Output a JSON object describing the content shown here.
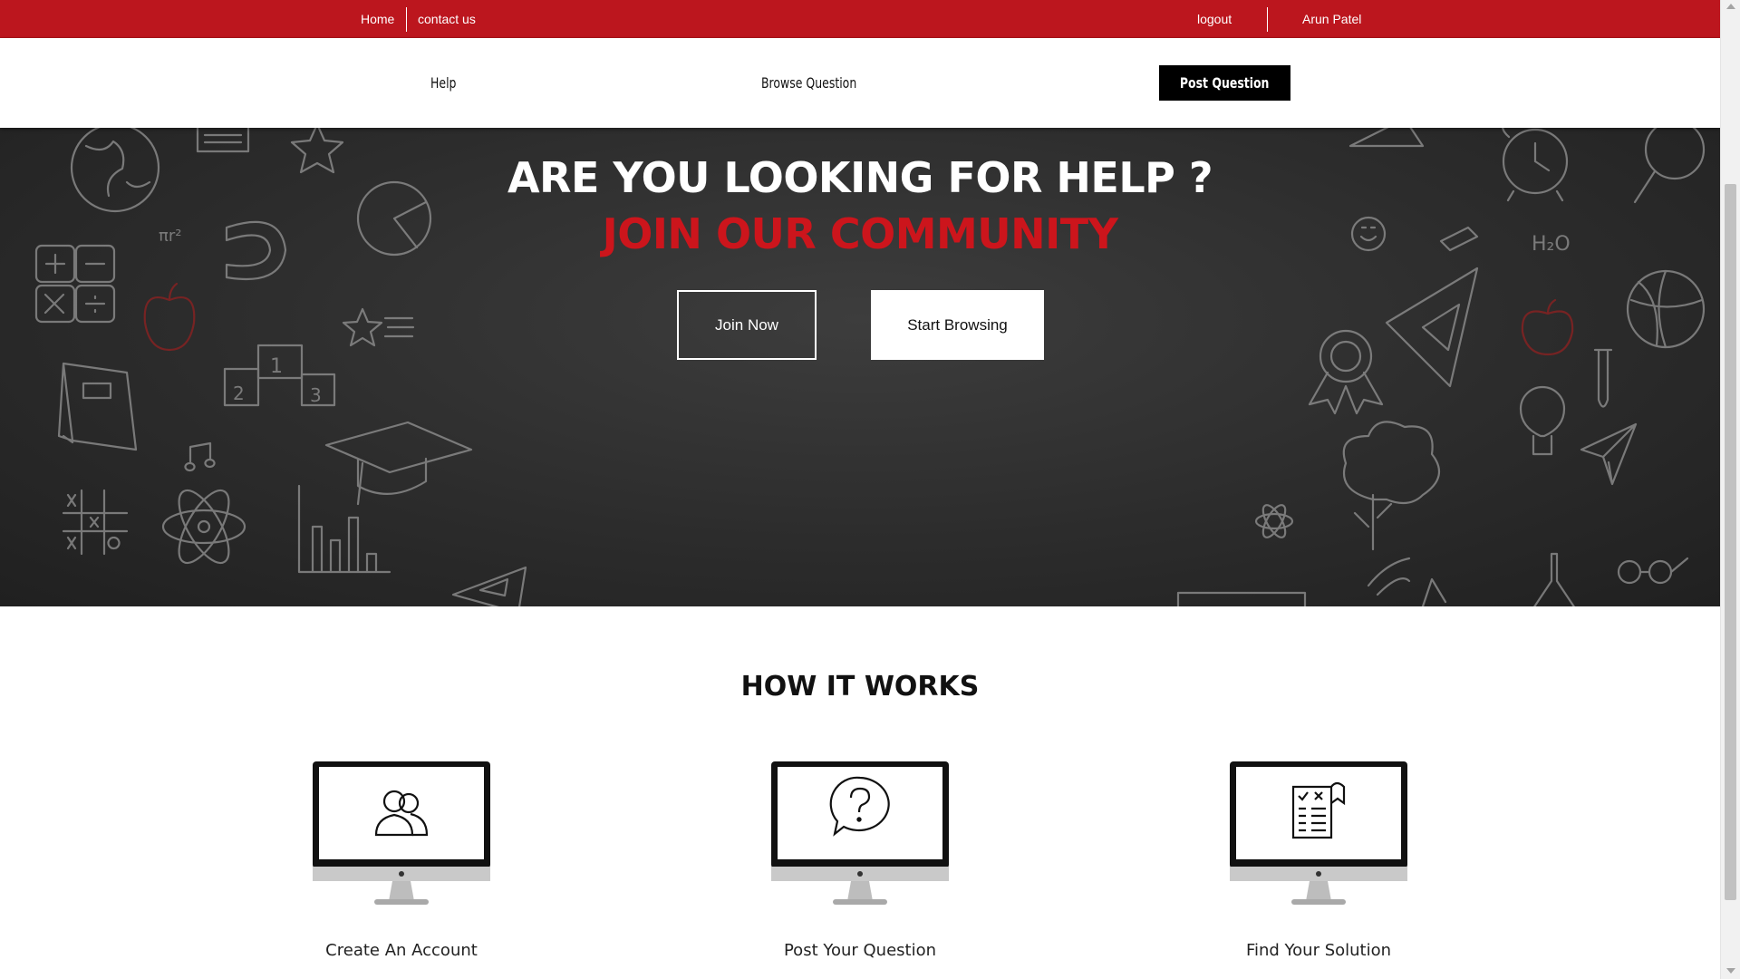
{
  "topbar": {
    "home": "Home",
    "contact": "contact us",
    "logout": "logout",
    "user": "Arun Patel",
    "bg_color": "#bc161e"
  },
  "nav": {
    "help": "Help",
    "browse": "Browse Question",
    "post": "Post Question"
  },
  "hero": {
    "headline": "ARE YOU LOOKING FOR HELP ?",
    "subheadline": "JOIN OUR COMMUNITY",
    "join_button": "Join Now",
    "browse_button": "Start Browsing",
    "accent_color": "#cc151c"
  },
  "how": {
    "title": "HOW IT WORKS",
    "steps": [
      {
        "label": "Create An Account",
        "icon": "users-icon"
      },
      {
        "label": "Post Your Question",
        "icon": "question-bubble-icon"
      },
      {
        "label": "Find Your Solution",
        "icon": "checklist-document-icon"
      }
    ]
  }
}
